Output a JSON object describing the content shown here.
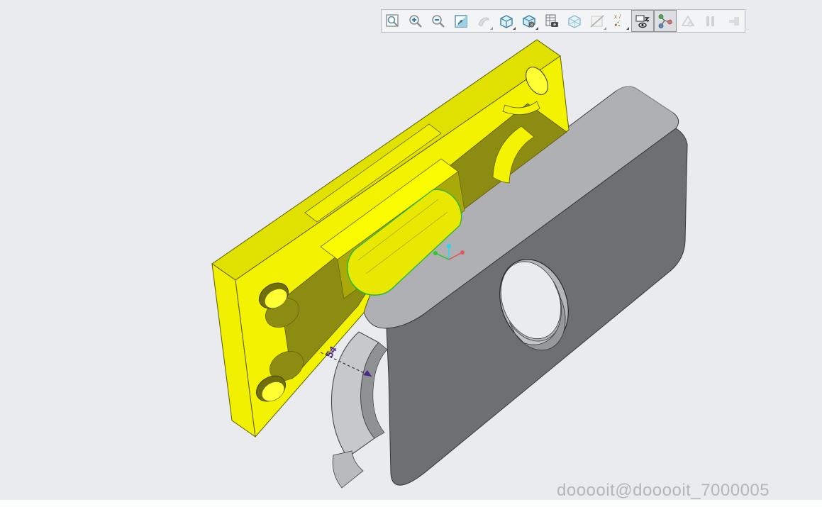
{
  "app": {
    "watermark": "dooooit@dooooit_7000005"
  },
  "annotation": {
    "dimension_label": "54"
  },
  "toolbar": {
    "buttons": [
      {
        "icon": "zoom-window-icon",
        "state": "normal"
      },
      {
        "icon": "zoom-in-icon",
        "state": "normal"
      },
      {
        "icon": "zoom-out-icon",
        "state": "normal"
      },
      {
        "icon": "zoom-fit-icon",
        "state": "normal"
      },
      {
        "icon": "refresh-view-icon",
        "state": "disabled"
      },
      {
        "icon": "shaded-view-cube-icon",
        "state": "normal"
      },
      {
        "icon": "view-style-cube-icon",
        "state": "normal"
      },
      {
        "icon": "snapshot-table-icon",
        "state": "normal"
      },
      {
        "icon": "transparent-view-cube-icon",
        "state": "normal"
      },
      {
        "icon": "section-view-icon",
        "state": "disabled"
      },
      {
        "icon": "datum-axes-icon",
        "state": "normal"
      },
      {
        "icon": "hide-show-icon",
        "state": "pressed"
      },
      {
        "icon": "explode-view-icon",
        "state": "pressed"
      },
      {
        "icon": "interference-check-icon",
        "state": "disabled"
      },
      {
        "icon": "pause-icon",
        "state": "disabled"
      },
      {
        "icon": "return-icon",
        "state": "disabled"
      }
    ]
  },
  "scene": {
    "parts": [
      {
        "name": "cavity-plate",
        "description": "yellow mold plate with pocket, slot and holes"
      },
      {
        "name": "core-plate",
        "description": "gray rounded plate with center hole and side notch"
      }
    ],
    "selected_feature": "half-cylinder slot highlighted green"
  },
  "colors": {
    "background": "#e9ebee",
    "yellow_bright": "#f2f201",
    "yellow_strip": "#e0e001",
    "yellow_pocket": "#8c8c12",
    "yellow_hole_inner": "#ffff33",
    "gray_top": "#aeb0b3",
    "gray_front": "#6d6f71",
    "gray_wall": "#c6c8ca",
    "selection_green": "#2eb82e",
    "dimension_purple": "#4b2a8a",
    "triad_x_red": "#e05a5a",
    "triad_y_green": "#35c435",
    "triad_z_cyan": "#29d8e8",
    "watermark_gray": "#b4b6ba"
  }
}
